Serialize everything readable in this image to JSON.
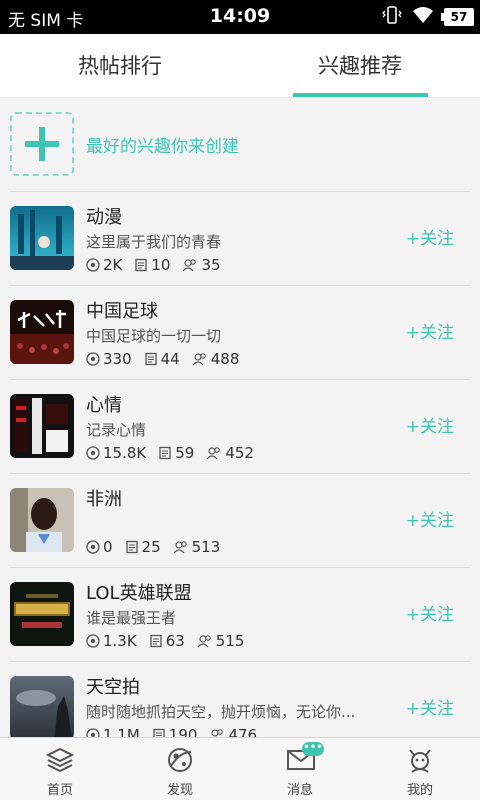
{
  "status_bar": {
    "carrier": "无 SIM 卡",
    "time": "14:09",
    "battery": "57"
  },
  "tabs": [
    {
      "label": "热帖排行",
      "active": false
    },
    {
      "label": "兴趣推荐",
      "active": true
    }
  ],
  "accent_color": "#3ec4b3",
  "create": {
    "label": "最好的兴趣你来创建"
  },
  "items": [
    {
      "title": "动漫",
      "desc": "这里属于我们的青春",
      "coins": "2K",
      "posts": "10",
      "members": "35",
      "follow": "+关注"
    },
    {
      "title": "中国足球",
      "desc": "中国足球的一切一切",
      "coins": "330",
      "posts": "44",
      "members": "488",
      "follow": "+关注"
    },
    {
      "title": "心情",
      "desc": "记录心情",
      "coins": "15.8K",
      "posts": "59",
      "members": "452",
      "follow": "+关注"
    },
    {
      "title": "非洲",
      "desc": "",
      "coins": "0",
      "posts": "25",
      "members": "513",
      "follow": "+关注"
    },
    {
      "title": "LOL英雄联盟",
      "desc": "谁是最强王者",
      "coins": "1.3K",
      "posts": "63",
      "members": "515",
      "follow": "+关注"
    },
    {
      "title": "天空拍",
      "desc": "随时随地抓拍天空，抛开烦恼，无论你...",
      "coins": "1.1M",
      "posts": "190",
      "members": "476",
      "follow": "+关注"
    }
  ],
  "nav": [
    {
      "label": "首页",
      "icon": "layers-icon"
    },
    {
      "label": "发现",
      "icon": "planet-icon"
    },
    {
      "label": "消息",
      "icon": "message-icon",
      "badge": "•••"
    },
    {
      "label": "我的",
      "icon": "avatar-icon"
    }
  ]
}
